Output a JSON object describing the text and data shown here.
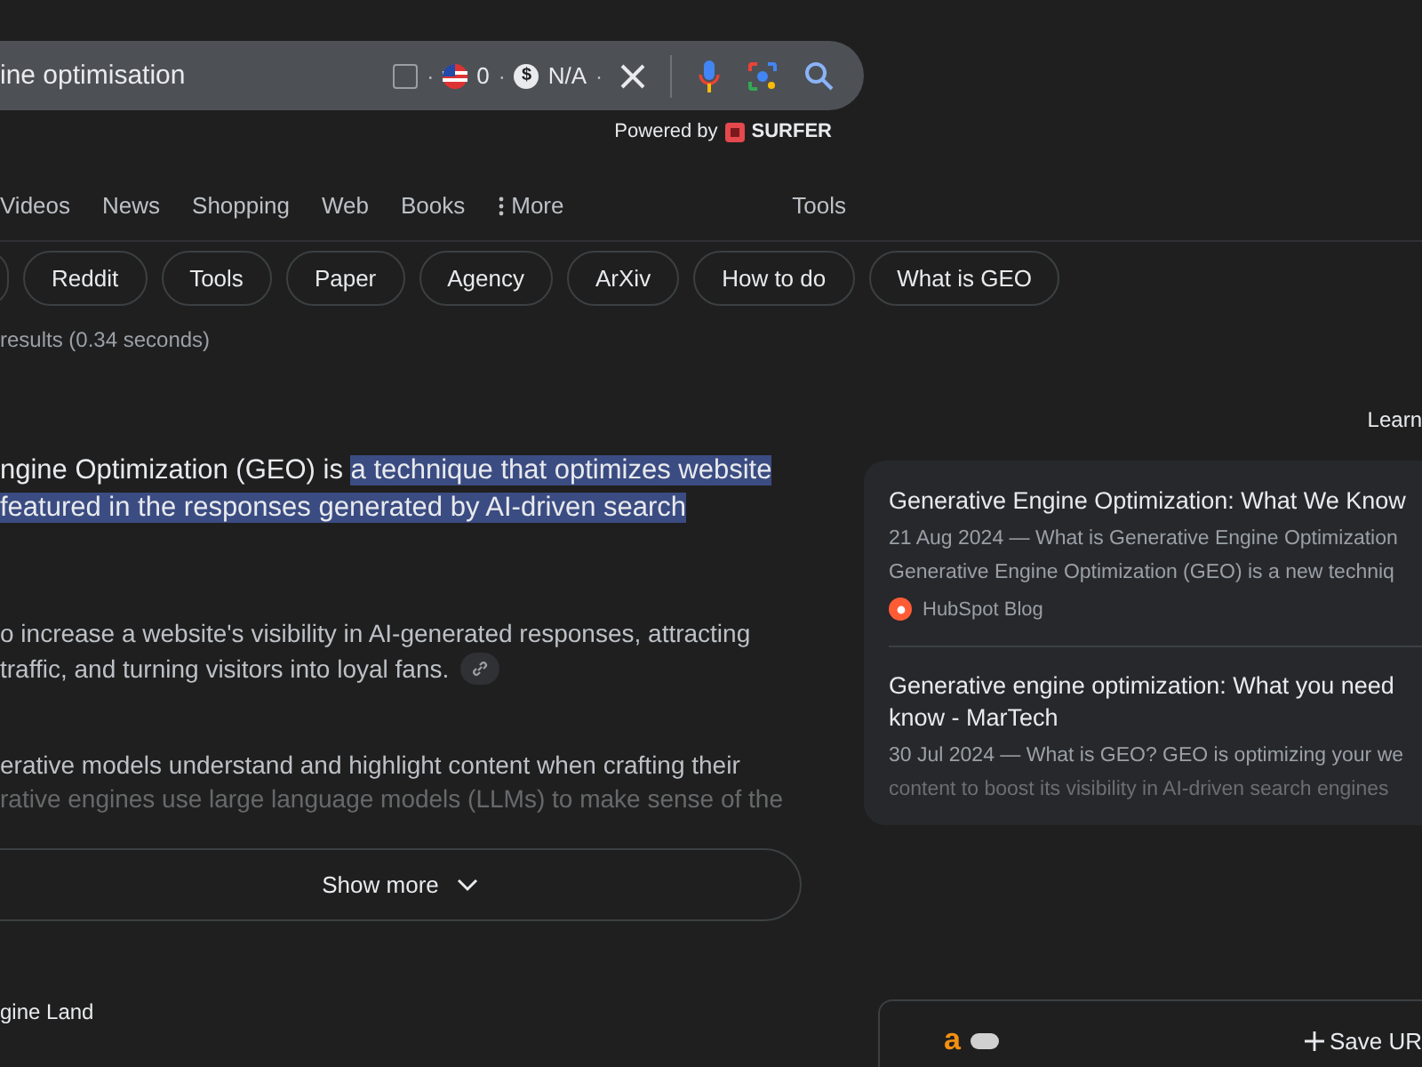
{
  "search": {
    "value": "ine optimisation",
    "metrics": [
      {
        "kind": "checkbox",
        "checked": false
      },
      {
        "kind": "sep",
        "text": "·"
      },
      {
        "kind": "flag",
        "text": "0"
      },
      {
        "kind": "sep",
        "text": "·"
      },
      {
        "kind": "dollar",
        "symbol": "$",
        "text": "N/A"
      },
      {
        "kind": "sep",
        "text": "·"
      }
    ],
    "powered_by": {
      "label": "Powered by",
      "brand": "SURFER"
    }
  },
  "tabs": [
    {
      "label": "Videos",
      "kind": "tab"
    },
    {
      "label": "News",
      "kind": "tab"
    },
    {
      "label": "Shopping",
      "kind": "tab"
    },
    {
      "label": "Web",
      "kind": "tab"
    },
    {
      "label": "Books",
      "kind": "tab"
    },
    {
      "label": "More",
      "kind": "more"
    }
  ],
  "tools_label": "Tools",
  "chips": [
    "Reddit",
    "Tools",
    "Paper",
    "Agency",
    "ArXiv",
    "How to do",
    "What is GEO"
  ],
  "result_stats": "results (0.34 seconds)",
  "snippet": {
    "lines": [
      [
        {
          "text": "ngine Optimization (GEO) is ",
          "highlighted": false
        },
        {
          "text": "a technique that optimizes website",
          "highlighted": true
        }
      ],
      [
        {
          "text": "featured in the responses generated by AI-driven search",
          "highlighted": true
        }
      ]
    ],
    "paragraph": [
      "o increase a website's visibility in AI-generated responses, attracting",
      "traffic, and turning visitors into loyal fans."
    ],
    "faded": [
      "erative models understand and highlight content when crafting their",
      "rative engines use large language models (LLMs) to make sense of the"
    ],
    "show_more": "Show more"
  },
  "learn_more": "Learn",
  "sources": [
    {
      "title": "Generative Engine Optimization: What We Know",
      "lines": [
        "21 Aug 2024 — What is Generative Engine Optimization",
        "Generative Engine Optimization (GEO) is a new techniq"
      ],
      "site": "HubSpot Blog",
      "faded": false
    },
    {
      "title": "Generative engine optimization: What you need",
      "title2": "know - MarTech",
      "lines": [
        "30 Jul 2024 — What is GEO? GEO is optimizing your we",
        "content to boost its visibility in AI-driven search engines"
      ],
      "faded": true
    }
  ],
  "next_result": {
    "source": "gine Land"
  },
  "extension": {
    "logo": "a",
    "toggle_on": false,
    "save_label": "Save UR"
  }
}
